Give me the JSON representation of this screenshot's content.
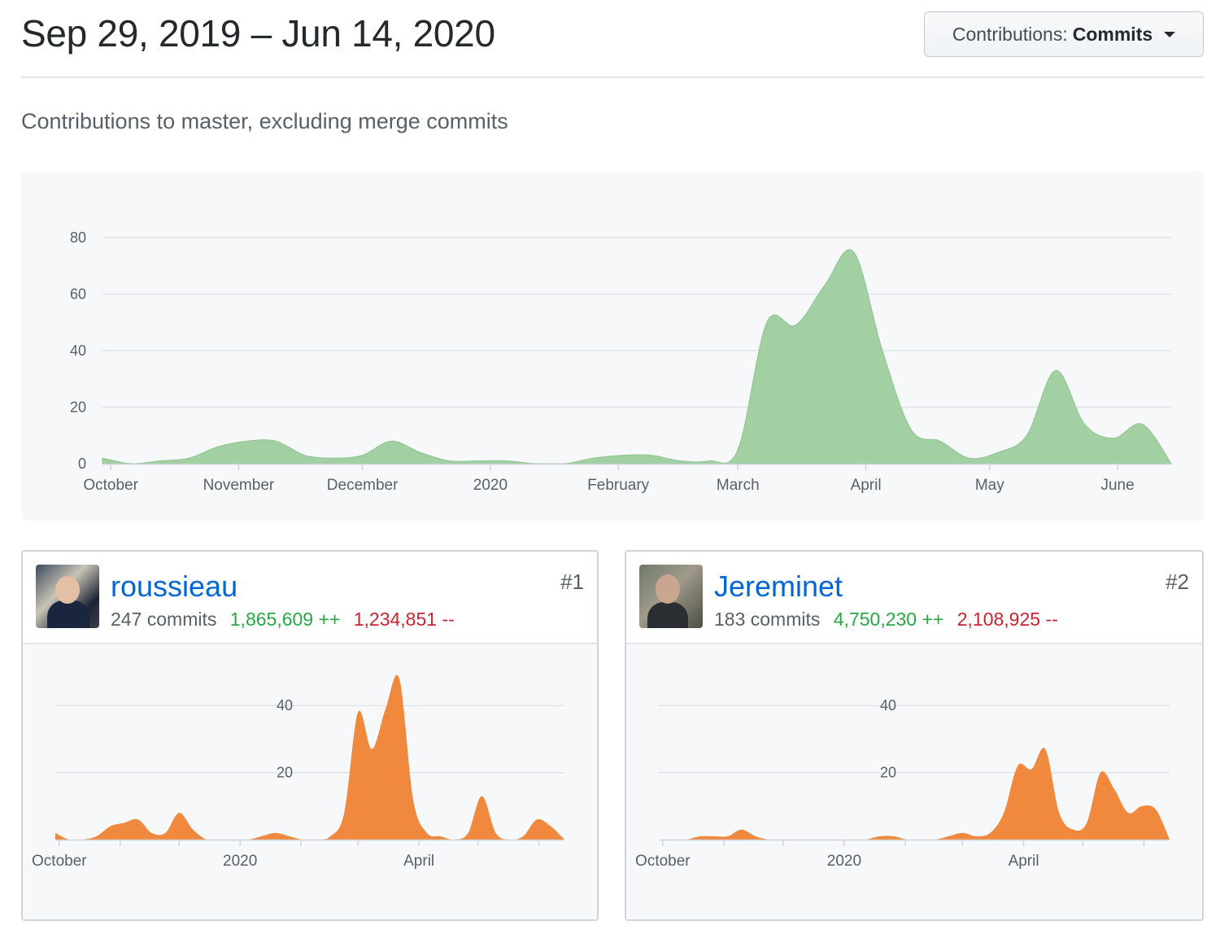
{
  "header": {
    "date_range": "Sep 29, 2019 – Jun 14, 2020",
    "contributions_prefix": "Contributions:",
    "contributions_value": "Commits",
    "subtitle": "Contributions to master, excluding merge commits"
  },
  "colors": {
    "main_area": "#a3d0a3",
    "main_area_stroke": "#8cc38c",
    "contributor_area": "#f0883e",
    "link": "#0366d6",
    "additions": "#28a745",
    "deletions": "#cb2431"
  },
  "chart_data": [
    {
      "type": "area",
      "title": "",
      "x_ticks": [
        "October",
        "November",
        "December",
        "2020",
        "February",
        "March",
        "April",
        "May",
        "June"
      ],
      "y_ticks": [
        0,
        20,
        40,
        60,
        80
      ],
      "ylim": [
        0,
        80
      ],
      "grid": true,
      "series": [
        {
          "x": [
            "2019-09-29",
            "2019-10-06",
            "2019-10-13",
            "2019-10-20",
            "2019-10-27",
            "2019-11-03",
            "2019-11-10",
            "2019-11-17",
            "2019-11-24",
            "2019-12-01",
            "2019-12-08",
            "2019-12-15",
            "2019-12-22",
            "2019-12-29",
            "2020-01-05",
            "2020-01-12",
            "2020-01-19",
            "2020-01-26",
            "2020-02-02",
            "2020-02-09",
            "2020-02-16",
            "2020-02-23",
            "2020-03-01",
            "2020-03-08",
            "2020-03-15",
            "2020-03-22",
            "2020-03-29",
            "2020-04-05",
            "2020-04-12",
            "2020-04-19",
            "2020-04-26",
            "2020-05-03",
            "2020-05-10",
            "2020-05-17",
            "2020-05-24",
            "2020-05-31",
            "2020-06-07",
            "2020-06-14"
          ],
          "values": [
            2,
            0,
            1,
            2,
            6,
            8,
            8,
            3,
            2,
            3,
            8,
            4,
            1,
            1,
            1,
            0,
            0,
            2,
            3,
            3,
            1,
            1,
            5,
            50,
            49,
            63,
            75,
            40,
            12,
            8,
            2,
            4,
            10,
            33,
            14,
            9,
            14,
            0
          ]
        }
      ]
    },
    {
      "type": "area",
      "title": "",
      "x_ticks": [
        "October",
        "2020",
        "April"
      ],
      "y_ticks": [
        20,
        40
      ],
      "ylim": [
        0,
        50
      ],
      "grid": true,
      "series": [
        {
          "x": [
            "2019-09-29",
            "2019-10-06",
            "2019-10-13",
            "2019-10-20",
            "2019-10-27",
            "2019-11-03",
            "2019-11-10",
            "2019-11-17",
            "2019-11-24",
            "2019-12-01",
            "2019-12-08",
            "2019-12-15",
            "2019-12-22",
            "2019-12-29",
            "2020-01-05",
            "2020-01-12",
            "2020-01-19",
            "2020-01-26",
            "2020-02-02",
            "2020-02-09",
            "2020-02-16",
            "2020-02-23",
            "2020-03-01",
            "2020-03-08",
            "2020-03-15",
            "2020-03-22",
            "2020-03-29",
            "2020-04-05",
            "2020-04-12",
            "2020-04-19",
            "2020-04-26",
            "2020-05-03",
            "2020-05-10",
            "2020-05-17",
            "2020-05-24",
            "2020-05-31",
            "2020-06-07",
            "2020-06-14"
          ],
          "values": [
            2,
            0,
            0,
            1,
            4,
            5,
            6,
            2,
            2,
            8,
            3,
            0,
            0,
            0,
            0,
            1,
            2,
            1,
            0,
            0,
            1,
            8,
            38,
            27,
            39,
            48,
            12,
            2,
            1,
            0,
            2,
            13,
            2,
            0,
            1,
            6,
            4,
            0
          ]
        }
      ]
    },
    {
      "type": "area",
      "title": "",
      "x_ticks": [
        "October",
        "2020",
        "April"
      ],
      "y_ticks": [
        20,
        40
      ],
      "ylim": [
        0,
        50
      ],
      "grid": true,
      "series": [
        {
          "x": [
            "2019-09-29",
            "2019-10-06",
            "2019-10-13",
            "2019-10-20",
            "2019-10-27",
            "2019-11-03",
            "2019-11-10",
            "2019-11-17",
            "2019-11-24",
            "2019-12-01",
            "2019-12-08",
            "2019-12-15",
            "2019-12-22",
            "2019-12-29",
            "2020-01-05",
            "2020-01-12",
            "2020-01-19",
            "2020-01-26",
            "2020-02-02",
            "2020-02-09",
            "2020-02-16",
            "2020-02-23",
            "2020-03-01",
            "2020-03-08",
            "2020-03-15",
            "2020-03-22",
            "2020-03-29",
            "2020-04-05",
            "2020-04-12",
            "2020-04-19",
            "2020-04-26",
            "2020-05-03",
            "2020-05-10",
            "2020-05-17",
            "2020-05-24",
            "2020-05-31",
            "2020-06-07",
            "2020-06-14"
          ],
          "values": [
            0,
            0,
            0,
            1,
            1,
            1,
            3,
            1,
            0,
            0,
            0,
            0,
            0,
            0,
            0,
            0,
            1,
            1,
            0,
            0,
            0,
            1,
            2,
            1,
            2,
            8,
            22,
            21,
            27,
            8,
            3,
            5,
            20,
            15,
            8,
            10,
            9,
            0
          ]
        }
      ]
    }
  ],
  "contributors": [
    {
      "username": "roussieau",
      "commits": "247 commits",
      "additions": "1,865,609 ++",
      "deletions": "1,234,851 --",
      "rank": "#1"
    },
    {
      "username": "Jereminet",
      "commits": "183 commits",
      "additions": "4,750,230 ++",
      "deletions": "2,108,925 --",
      "rank": "#2"
    }
  ]
}
